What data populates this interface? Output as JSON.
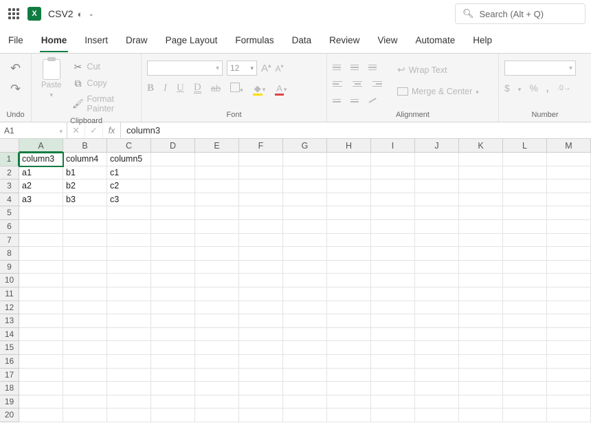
{
  "title": {
    "doc_name": "CSV2"
  },
  "search": {
    "placeholder": "Search (Alt + Q)"
  },
  "tabs": [
    "File",
    "Home",
    "Insert",
    "Draw",
    "Page Layout",
    "Formulas",
    "Data",
    "Review",
    "View",
    "Automate",
    "Help"
  ],
  "active_tab": "Home",
  "ribbon": {
    "undo_label": "Undo",
    "paste_label": "Paste",
    "clipboard_label": "Clipboard",
    "cut_label": "Cut",
    "copy_label": "Copy",
    "format_painter_label": "Format Painter",
    "font_label": "Font",
    "font_size": "12",
    "alignment_label": "Alignment",
    "wrap_text_label": "Wrap Text",
    "merge_center_label": "Merge & Center",
    "number_label": "Number",
    "bold": "B",
    "italic": "I",
    "underline": "U",
    "dunderline": "D",
    "strike": "ab",
    "increase_font": "A",
    "decrease_font": "A",
    "currency": "$",
    "percent": "%",
    "comma": ","
  },
  "name_box": "A1",
  "formula_bar": "column3",
  "columns": [
    "A",
    "B",
    "C",
    "D",
    "E",
    "F",
    "G",
    "H",
    "I",
    "J",
    "K",
    "L",
    "M"
  ],
  "rows": 20,
  "selected_cell": {
    "row": 1,
    "col": 0
  },
  "cells": {
    "1": [
      "column3",
      "column4",
      "column5"
    ],
    "2": [
      "a1",
      "b1",
      "c1"
    ],
    "3": [
      "a2",
      "b2",
      "c2"
    ],
    "4": [
      "a3",
      "b3",
      "c3"
    ]
  }
}
